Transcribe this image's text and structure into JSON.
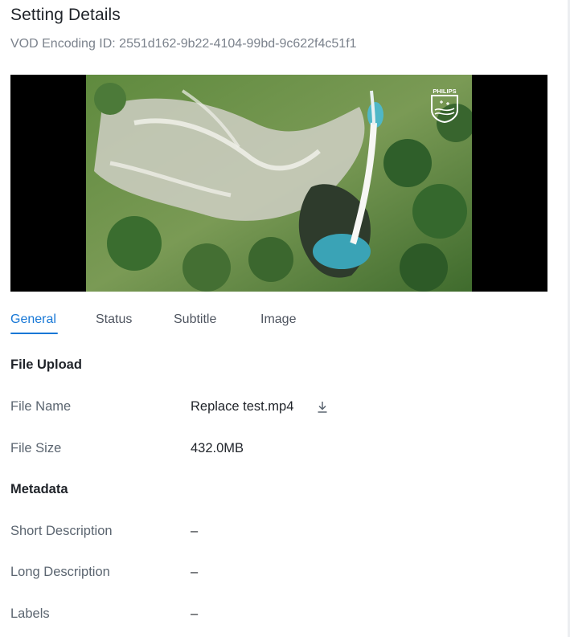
{
  "header": {
    "title": "Setting Details",
    "subtitle": "VOD Encoding ID: 2551d162-9b22-4104-99bd-9c622f4c51f1"
  },
  "video": {
    "logo_text": "PHILIPS",
    "thumbnail": "aerial-waterfall-forest"
  },
  "tabs": [
    {
      "label": "General",
      "active": true
    },
    {
      "label": "Status",
      "active": false
    },
    {
      "label": "Subtitle",
      "active": false
    },
    {
      "label": "Image",
      "active": false
    }
  ],
  "sections": {
    "file_upload": "File Upload",
    "metadata": "Metadata"
  },
  "fields": {
    "file_name": {
      "label": "File Name",
      "value": "Replace test.mp4"
    },
    "file_size": {
      "label": "File Size",
      "value": "432.0MB"
    },
    "short_description": {
      "label": "Short Description",
      "value": "–"
    },
    "long_description": {
      "label": "Long Description",
      "value": "–"
    },
    "labels": {
      "label": "Labels",
      "value": "–"
    }
  },
  "icons": {
    "download": "download-icon"
  },
  "colors": {
    "accent": "#1677d6",
    "label": "#5b6570",
    "muted": "#7b828c"
  }
}
